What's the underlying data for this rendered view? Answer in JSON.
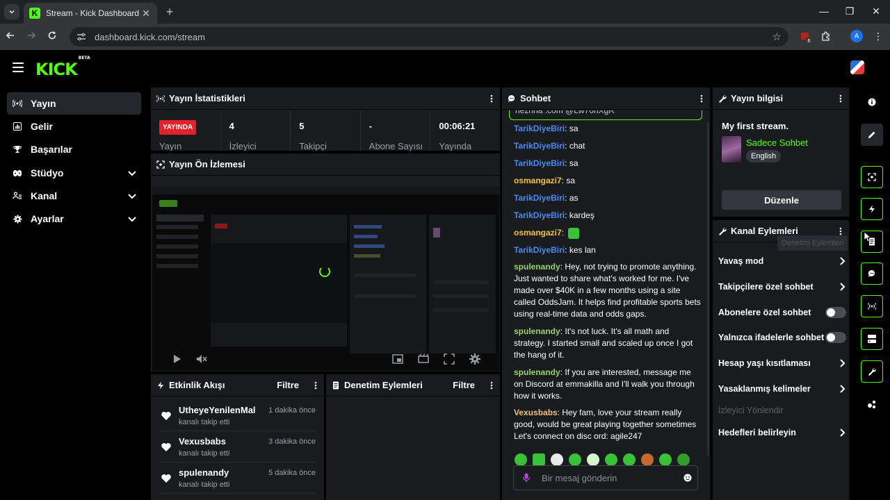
{
  "browser": {
    "tab_title": "Stream - Kick Dashboard",
    "favicon_letter": "K",
    "url": "dashboard.kick.com/stream",
    "extension_badge": "6",
    "profile_initial": "A"
  },
  "header": {
    "logo": "KICK",
    "logo_badge": "BETA"
  },
  "sidebar": {
    "items": [
      {
        "label": "Yayın",
        "icon": "broadcast-icon",
        "active": true
      },
      {
        "label": "Gelir",
        "icon": "revenue-icon"
      },
      {
        "label": "Başarılar",
        "icon": "trophy-icon"
      },
      {
        "label": "Stüdyo",
        "icon": "studio-icon",
        "expandable": true
      },
      {
        "label": "Kanal",
        "icon": "channel-icon",
        "expandable": true
      },
      {
        "label": "Ayarlar",
        "icon": "gear-icon",
        "expandable": true
      }
    ]
  },
  "stats": {
    "title": "Yayın İstatistikleri",
    "live_badge": "YAYINDA",
    "status_label": "Yayın",
    "viewers_value": "4",
    "viewers_label": "İzleyici",
    "followers_value": "5",
    "followers_label": "Takipçi",
    "subs_value": "-",
    "subs_label": "Abone Sayısı",
    "uptime_value": "00:06:21",
    "uptime_label": "Yayında"
  },
  "preview": {
    "title": "Yayın Ön İzlemesi"
  },
  "activity": {
    "title": "Etkinlik Akışı",
    "filter": "Filtre",
    "items": [
      {
        "name": "UtheyeYenilenMal",
        "action": "kanalı takip etti",
        "time": "1 dakika önce"
      },
      {
        "name": "Vexusbabs",
        "action": "kanalı takip etti",
        "time": "3 dakika önce"
      },
      {
        "name": "spulenandy",
        "action": "kanalı takip etti",
        "time": "5 dakika önce"
      }
    ]
  },
  "moderation": {
    "title": "Denetim Eylemleri",
    "filter": "Filtre"
  },
  "chat": {
    "title": "Sohbet",
    "pinned_partial": "hezhna .com @Lw70hXgR",
    "messages": [
      {
        "user": "TarikDiyeBiri",
        "text": ": sa"
      },
      {
        "user": "TarikDiyeBiri",
        "text": ": chat"
      },
      {
        "user": "TarikDiyeBiri",
        "text": ": sa"
      },
      {
        "user": "osmangazi7",
        "text": ": sa"
      },
      {
        "user": "TarikDiyeBiri",
        "text": ": as"
      },
      {
        "user": "TarikDiyeBiri",
        "text": ": kardeş"
      },
      {
        "user": "osmangazi7",
        "text": ":"
      },
      {
        "user": "TarikDiyeBiri",
        "text": ": kes lan"
      },
      {
        "user": "spulenandy",
        "text": ": Hey, not trying to promote anything. Just wanted to share what's worked for me. I've made over $40K in a few months using a site called OddsJam. It helps find profitable sports bets using real-time data and odds gaps."
      },
      {
        "user": "spulenandy",
        "text": ": It's not luck. It's all math and strategy. I started small and scaled up once I got the hang of it."
      },
      {
        "user": "spulenandy",
        "text": ": If you are interested, message me on Discord at emmakilla and I'll walk you through how it works."
      },
      {
        "user": "Vexusbabs",
        "text": ": Hey fam, love your stream really good, would be great playing together sometimes Let's connect on disc ord: agile247"
      }
    ],
    "input_placeholder": "Bir mesaj gönderin"
  },
  "stream_info": {
    "title": "Yayın bilgisi",
    "stream_title": "My first stream.",
    "category": "Sadece Sohbet",
    "language": "English",
    "edit_button": "Düzenle"
  },
  "channel_actions": {
    "title": "Kanal Eylemleri",
    "tooltip": "Denetim Eylemleri",
    "items": [
      {
        "label": "Yavaş mod",
        "control": "chevron"
      },
      {
        "label": "Takipçilere özel sohbet",
        "control": "chevron"
      },
      {
        "label": "Abonelere özel sohbet",
        "control": "toggle"
      },
      {
        "label": "Yalnızca ifadelerle sohbet",
        "control": "toggle"
      },
      {
        "label": "Hesap yaşı kısıtlaması",
        "control": "chevron"
      },
      {
        "label": "Yasaklanmış kelimeler",
        "control": "chevron"
      },
      {
        "label": "İzleyici Yönlendir",
        "control": "none",
        "disabled": true
      },
      {
        "label": "Hedefleri belirleyin",
        "control": "chevron"
      }
    ]
  },
  "colors": {
    "brand": "#53fc18",
    "live": "#e5212c",
    "panel": "#191b1f"
  }
}
